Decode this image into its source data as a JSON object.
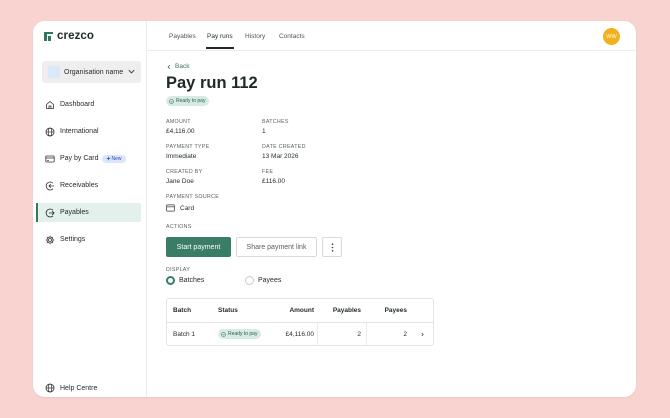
{
  "brand": {
    "name": "crezco",
    "color": "#2f7a5f"
  },
  "organisation": {
    "name": "Organisation name"
  },
  "sidebar": {
    "items": [
      {
        "label": "Dashboard",
        "icon": "home-icon"
      },
      {
        "label": "International",
        "icon": "globe-icon"
      },
      {
        "label": "Pay by Card",
        "icon": "card-icon",
        "badge": "New"
      },
      {
        "label": "Receivables",
        "icon": "arrow-in-icon"
      },
      {
        "label": "Payables",
        "icon": "arrow-out-icon",
        "active": true
      },
      {
        "label": "Settings",
        "icon": "gear-icon"
      }
    ],
    "help": "Help Centre"
  },
  "tabs": [
    {
      "label": "Payables"
    },
    {
      "label": "Pay runs",
      "active": true
    },
    {
      "label": "History"
    },
    {
      "label": "Contacts"
    }
  ],
  "user": {
    "initials": "WW",
    "avatar_color": "#f2b11c"
  },
  "page": {
    "back": "Back",
    "title": "Pay run 112",
    "status": "Ready to pay"
  },
  "fields": {
    "amount": {
      "label": "AMOUNT",
      "value": "£4,116.00"
    },
    "batches": {
      "label": "BATCHES",
      "value": "1"
    },
    "payment_type": {
      "label": "PAYMENT TYPE",
      "value": "Immediate"
    },
    "date_created": {
      "label": "DATE CREATED",
      "value": "13 Mar 2026"
    },
    "created_by": {
      "label": "CREATED BY",
      "value": "Jane Doe"
    },
    "fee": {
      "label": "FEE",
      "value": "£116.00"
    },
    "payment_source": {
      "label": "PAYMENT SOURCE",
      "value": "Card"
    }
  },
  "actions": {
    "label": "ACTIONS",
    "start_payment": "Start payment",
    "share_link": "Share payment link"
  },
  "display": {
    "label": "DISPLAY",
    "options": [
      {
        "label": "Batches",
        "selected": true
      },
      {
        "label": "Payees",
        "selected": false
      }
    ]
  },
  "table": {
    "headers": {
      "batch": "Batch",
      "status": "Status",
      "amount": "Amount",
      "payables": "Payables",
      "payees": "Payees"
    },
    "rows": [
      {
        "batch": "Batch 1",
        "status": "Ready to pay",
        "amount": "£4,116.00",
        "payables": "2",
        "payees": "2"
      }
    ]
  },
  "colors": {
    "accent": "#3a7d66",
    "status_bg": "#d6ebe3",
    "background": "#f9d3cf"
  }
}
